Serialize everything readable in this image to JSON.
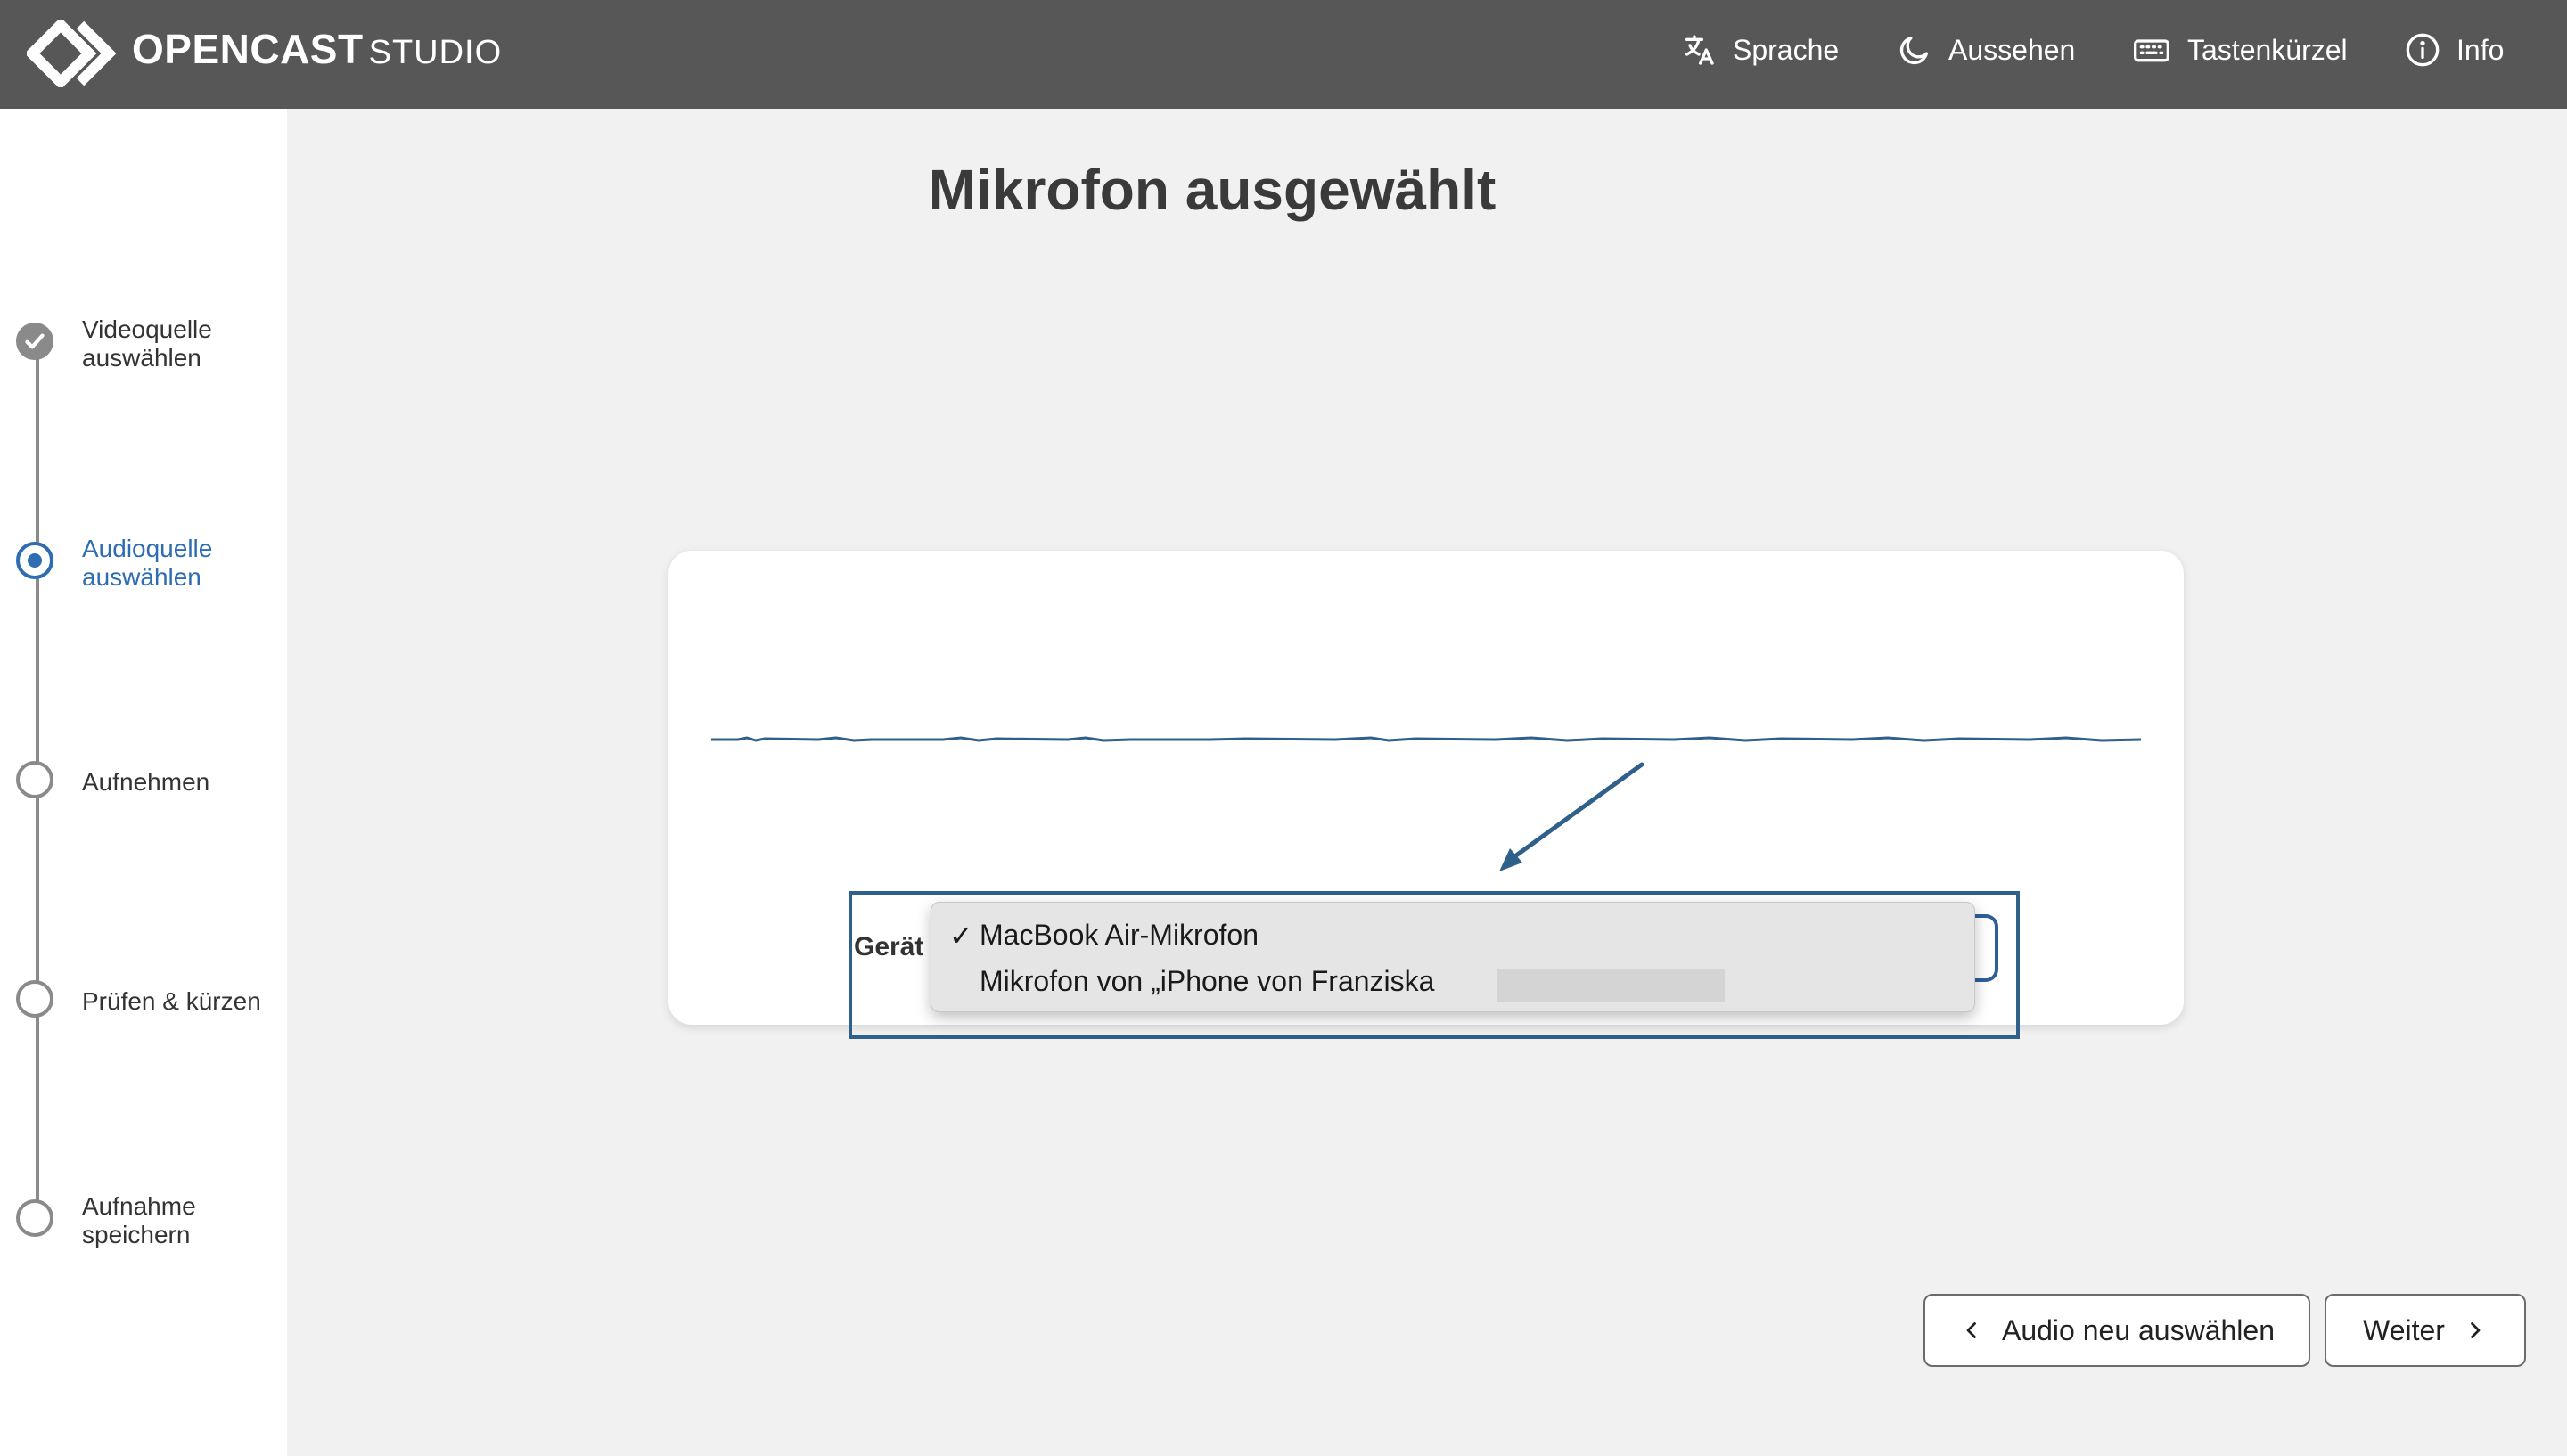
{
  "header": {
    "brand_bold": "OPENCAST",
    "brand_light": "STUDIO",
    "nav": [
      {
        "label": "Sprache",
        "icon": "translate-icon"
      },
      {
        "label": "Aussehen",
        "icon": "moon-icon"
      },
      {
        "label": "Tastenkürzel",
        "icon": "keyboard-icon"
      },
      {
        "label": "Info",
        "icon": "info-icon"
      }
    ]
  },
  "steps": [
    {
      "line1": "Videoquelle",
      "line2": "auswählen",
      "state": "done"
    },
    {
      "line1": "Audioquelle",
      "line2": "auswählen",
      "state": "active"
    },
    {
      "line1": "Aufnehmen",
      "line2": "",
      "state": "pending"
    },
    {
      "line1": "Prüfen & kürzen",
      "line2": "",
      "state": "pending"
    },
    {
      "line1": "Aufnahme",
      "line2": "speichern",
      "state": "pending"
    }
  ],
  "main": {
    "title": "Mikrofon ausgewählt",
    "device_label": "Gerät",
    "options": [
      {
        "label": "MacBook Air-Mikrofon",
        "selected": true
      },
      {
        "label": "Mikrofon von „iPhone von Franziska",
        "selected": false
      }
    ]
  },
  "buttons": {
    "back": "Audio neu auswählen",
    "next": "Weiter"
  },
  "colors": {
    "header_bg": "#575757",
    "accent": "#2f6db2",
    "highlight": "#2f6089"
  }
}
